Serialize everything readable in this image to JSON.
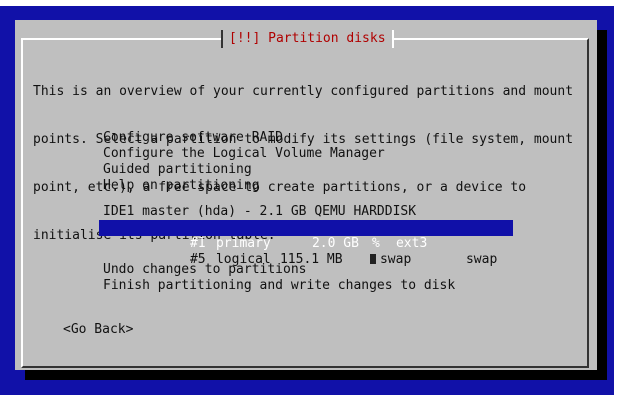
{
  "title": "[!!] Partition disks",
  "intro": [
    "This is an overview of your currently configured partitions and mount",
    "points. Select a partition to modify its settings (file system, mount",
    "point, etc.), a free space to create partitions, or a device to",
    "initialise its partition table."
  ],
  "menu_top": [
    "Configure software RAID",
    "Configure the Logical Volume Manager",
    "Guided partitioning",
    "Help on partitioning"
  ],
  "disk": "IDE1 master (hda) - 2.1 GB QEMU HARDDISK",
  "partitions": [
    {
      "id": "#1",
      "type": "primary",
      "size": "2.0 GB",
      "flag": "%",
      "fs": "ext3",
      "mount": ""
    },
    {
      "id": "#5",
      "type": "logical",
      "size": "115.1 MB",
      "flag": "",
      "fs": "swap",
      "mount": "swap"
    }
  ],
  "menu_bottom": [
    "Undo changes to partitions",
    "Finish partitioning and write changes to disk"
  ],
  "go_back": "<Go Back>",
  "colors": {
    "background": "#1111a8",
    "dialog": "#bfbfbf",
    "title": "#b00000",
    "selection": "#1010a8"
  }
}
